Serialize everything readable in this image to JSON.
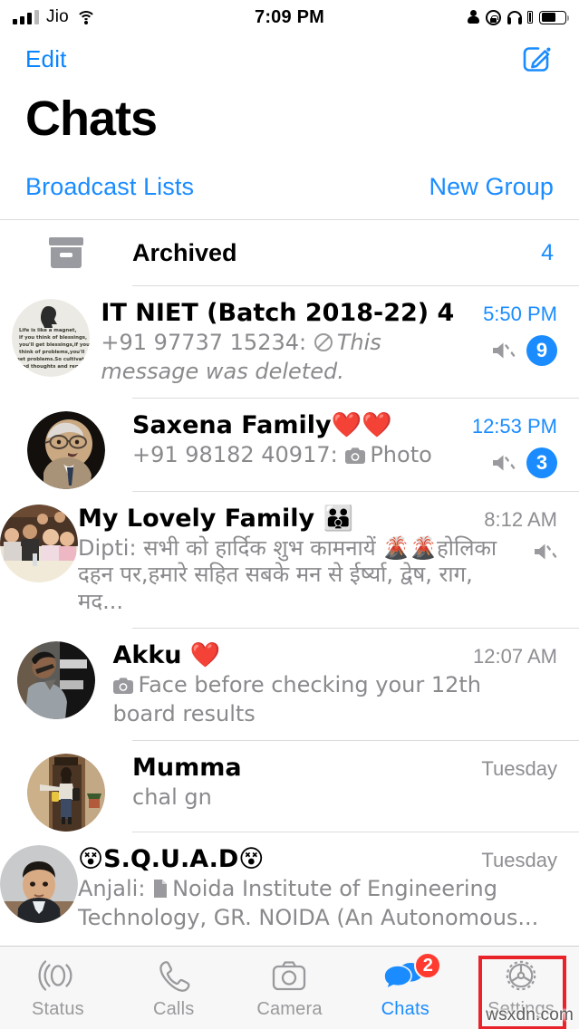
{
  "status_bar": {
    "carrier": "Jio",
    "time": "7:09 PM",
    "icons": [
      "signal-bars",
      "wifi-icon",
      "person-icon",
      "rotation-lock-icon",
      "headphones-icon",
      "battery-icon"
    ]
  },
  "navbar": {
    "edit_label": "Edit",
    "compose_icon": "compose-icon"
  },
  "header": {
    "title": "Chats",
    "broadcast_label": "Broadcast Lists",
    "new_group_label": "New Group"
  },
  "archived": {
    "label": "Archived",
    "count": "4",
    "icon": "archive-box-icon"
  },
  "colors": {
    "accent_blue": "#1a8cff",
    "badge_red": "#ff3b30",
    "muted_gray": "#8a8a8e",
    "highlight_red": "#e8232a"
  },
  "chats": [
    {
      "title": "IT NIET (Batch 2018-22) 4",
      "sender": "+91 97737 15234: ",
      "preview": "This message was deleted.",
      "preview_style": "italic",
      "preview_icon": "no-entry-icon",
      "time": "5:50 PM",
      "time_color": "blue",
      "muted": true,
      "unread": "9",
      "avatar": "quote-card-avatar"
    },
    {
      "title": "Saxena Family❤️❤️",
      "sender": "+91 98182 40917: ",
      "preview": "Photo",
      "preview_style": "normal",
      "preview_icon": "camera-icon",
      "time": "12:53 PM",
      "time_color": "blue",
      "muted": true,
      "unread": "3",
      "avatar": "elderly-man-avatar"
    },
    {
      "title": "My Lovely Family 👪",
      "sender": "Dipti: ",
      "preview": "सभी को हार्दिक शुभ कामनायें 🌋🌋होलिका दहन पर,हमारे सहित  सबके मन से ईर्ष्या, द्वेष, राग, मद...",
      "preview_style": "normal",
      "preview_icon": "",
      "time": "8:12 AM",
      "time_color": "gray",
      "muted": true,
      "unread": "",
      "avatar": "group-photo-avatar"
    },
    {
      "title": "Akku ❤️",
      "sender": "",
      "preview": "Face before checking your 12th board results",
      "preview_style": "normal",
      "preview_icon": "camera-icon",
      "time": "12:07 AM",
      "time_color": "gray",
      "muted": false,
      "unread": "",
      "avatar": "man-sunglasses-avatar"
    },
    {
      "title": "Mumma",
      "sender": "",
      "preview": "chal gn",
      "preview_style": "normal",
      "preview_icon": "",
      "time": "Tuesday",
      "time_color": "gray",
      "muted": false,
      "unread": "",
      "avatar": "woman-doorway-avatar"
    },
    {
      "title": "😵S.Q.U.A.D😵",
      "sender": "Anjali: ",
      "preview": "Noida Institute of Engineering Technology, GR. NOIDA (An Autonomous...",
      "preview_style": "normal",
      "preview_icon": "document-icon",
      "time": "Tuesday",
      "time_color": "gray",
      "muted": false,
      "unread": "",
      "avatar": "boy-portrait-avatar"
    }
  ],
  "tabbar": {
    "tabs": [
      {
        "label": "Status",
        "icon": "status-rings-icon",
        "active": false,
        "badge": ""
      },
      {
        "label": "Calls",
        "icon": "phone-icon",
        "active": false,
        "badge": ""
      },
      {
        "label": "Camera",
        "icon": "camera-icon",
        "active": false,
        "badge": ""
      },
      {
        "label": "Chats",
        "icon": "chat-bubbles-icon",
        "active": true,
        "badge": "2"
      },
      {
        "label": "Settings",
        "icon": "gear-icon",
        "active": false,
        "badge": ""
      }
    ],
    "highlighted_tab": "Settings"
  },
  "watermark": "wsxdn.com"
}
